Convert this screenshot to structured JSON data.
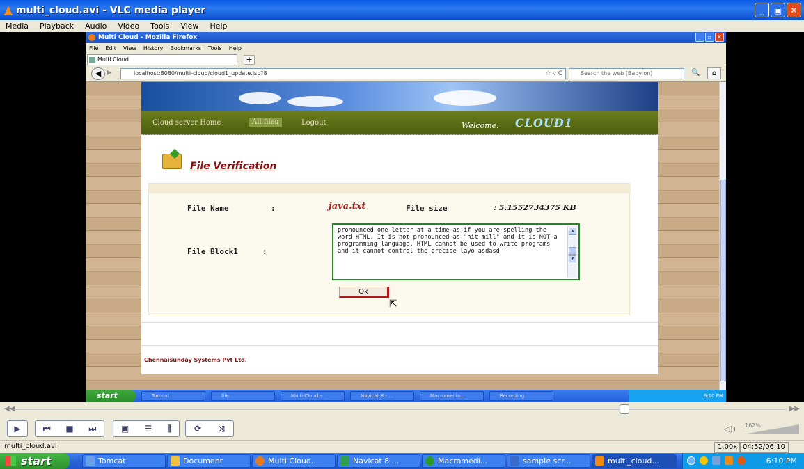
{
  "vlc": {
    "title": "multi_cloud.avi - VLC media player",
    "menu": [
      "Media",
      "Playback",
      "Audio",
      "Video",
      "Tools",
      "View",
      "Help"
    ],
    "filename": "multi_cloud.avi",
    "rate": "1.00x",
    "time": "04:52/06:10",
    "volume": "162%",
    "seek_progress": 0.79
  },
  "firefox": {
    "title": "Multi Cloud - Mozilla Firefox",
    "menu": [
      "File",
      "Edit",
      "View",
      "History",
      "Bookmarks",
      "Tools",
      "Help"
    ],
    "tab": "Multi Cloud",
    "url": "localhost:8080/multi-cloud/cloud1_update.jsp?8",
    "search_placeholder": "Search the web (Babylon)"
  },
  "site": {
    "nav": [
      "Cloud server Home",
      "All files",
      "Logout"
    ],
    "welcome_label": "Welcome:",
    "welcome_name": "CLOUD1",
    "section_title": "File Verification",
    "file_name_label": "File Name",
    "colon": ":",
    "file_name_value": "java.txt",
    "file_size_label": "File size",
    "file_size_value": ": 5.1552734375  KB",
    "file_block_label": "File Block1",
    "file_block_text": "pronounced one letter at a time as if you are spelling the word HTML. It is not pronounced as \"hit mill\" and it is NOT a programming language. HTML cannot be used to write programs and it cannot control the precise layo asdasd",
    "ok_label": "Ok",
    "footer": "Chennaisunday Systems Pvt Ltd."
  },
  "inner_taskbar": {
    "start": "start",
    "tasks": [
      "Tomcat",
      "file",
      "Multi Cloud - ...",
      "Navicat 8 - ...",
      "Macromedia...",
      "Recording"
    ],
    "clock": "6:10 PM"
  },
  "taskbar": {
    "start": "start",
    "tasks": [
      {
        "label": "Tomcat",
        "icon_color": "#6aa0e8"
      },
      {
        "label": "Document",
        "icon_color": "#f0c040"
      },
      {
        "label": "Multi Cloud...",
        "icon_color": "#e77b1b"
      },
      {
        "label": "Navicat 8 ...",
        "icon_color": "#2fa050"
      },
      {
        "label": "Macromedi...",
        "icon_color": "#2d9a2d"
      },
      {
        "label": "sample scr...",
        "icon_color": "#3a6ac8"
      },
      {
        "label": "multi_cloud...",
        "icon_color": "#f08a10"
      }
    ],
    "clock": "6:10 PM"
  }
}
